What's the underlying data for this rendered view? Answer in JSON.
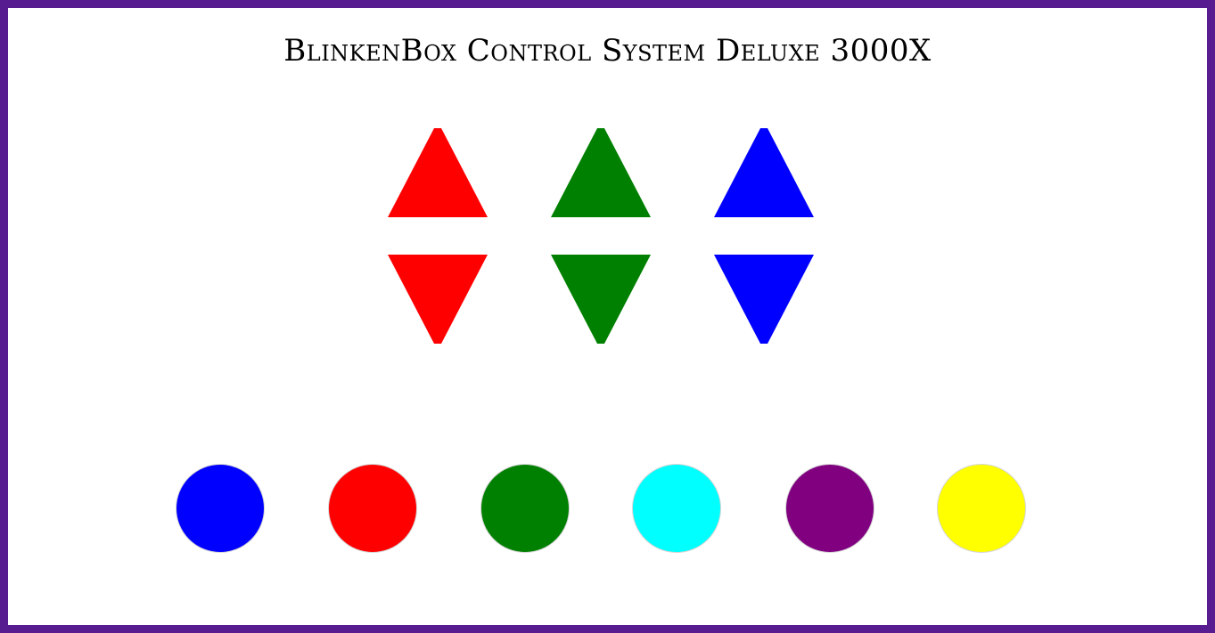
{
  "title": "BlinkenBox Control System Deluxe 3000X",
  "colors": {
    "frame": "#571c8f",
    "background": "#ffffff"
  },
  "channel_controls": [
    {
      "color": "#ff0000",
      "up_icon": "triangle-up-icon",
      "down_icon": "triangle-down-icon"
    },
    {
      "color": "#008000",
      "up_icon": "triangle-up-icon",
      "down_icon": "triangle-down-icon"
    },
    {
      "color": "#0000ff",
      "up_icon": "triangle-up-icon",
      "down_icon": "triangle-down-icon"
    }
  ],
  "color_buttons": [
    {
      "color": "#0000ff"
    },
    {
      "color": "#ff0000"
    },
    {
      "color": "#008000"
    },
    {
      "color": "#00ffff"
    },
    {
      "color": "#800080"
    },
    {
      "color": "#ffff00"
    }
  ]
}
